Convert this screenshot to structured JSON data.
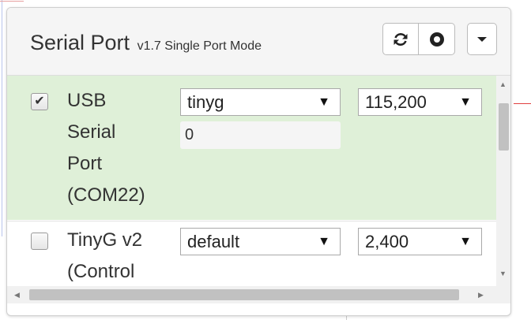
{
  "colors": {
    "selected_row": "#dff0d8",
    "heading_bg": "#f5f5f5"
  },
  "header": {
    "title": "Serial Port",
    "subtitle": "v1.7 Single Port Mode",
    "icons": [
      "refresh-icon",
      "circle-icon",
      "caret-down-icon"
    ]
  },
  "ports": [
    {
      "checked": true,
      "name_lines": [
        "USB",
        "Serial",
        "Port",
        "(COM22)"
      ],
      "buffer": "tinyg",
      "baud": "115,200",
      "field_value": "0"
    },
    {
      "checked": false,
      "name_lines": [
        "TinyG v2",
        "(Control"
      ],
      "buffer": "default",
      "baud": "2,400"
    }
  ]
}
